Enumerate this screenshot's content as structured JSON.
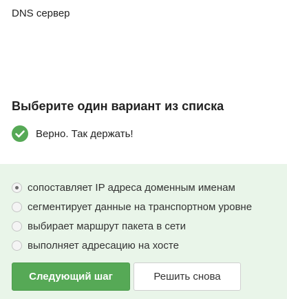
{
  "question": {
    "text": "DNS сервер"
  },
  "task": {
    "heading": "Выберите один вариант из списка"
  },
  "feedback": {
    "icon": "check-circle-icon",
    "text": "Верно. Так держать!",
    "color": "#56a956"
  },
  "options": [
    {
      "label": "сопоставляет IP адреса доменным именам",
      "selected": true
    },
    {
      "label": "сегментирует данные на транспортном уровне",
      "selected": false
    },
    {
      "label": "выбирает маршрут пакета в сети",
      "selected": false
    },
    {
      "label": "выполняет адресацию на хосте",
      "selected": false
    }
  ],
  "buttons": {
    "next_label": "Следующий шаг",
    "retry_label": "Решить снова"
  },
  "colors": {
    "accent": "#56a956",
    "panel_background": "#e9f5e9"
  }
}
